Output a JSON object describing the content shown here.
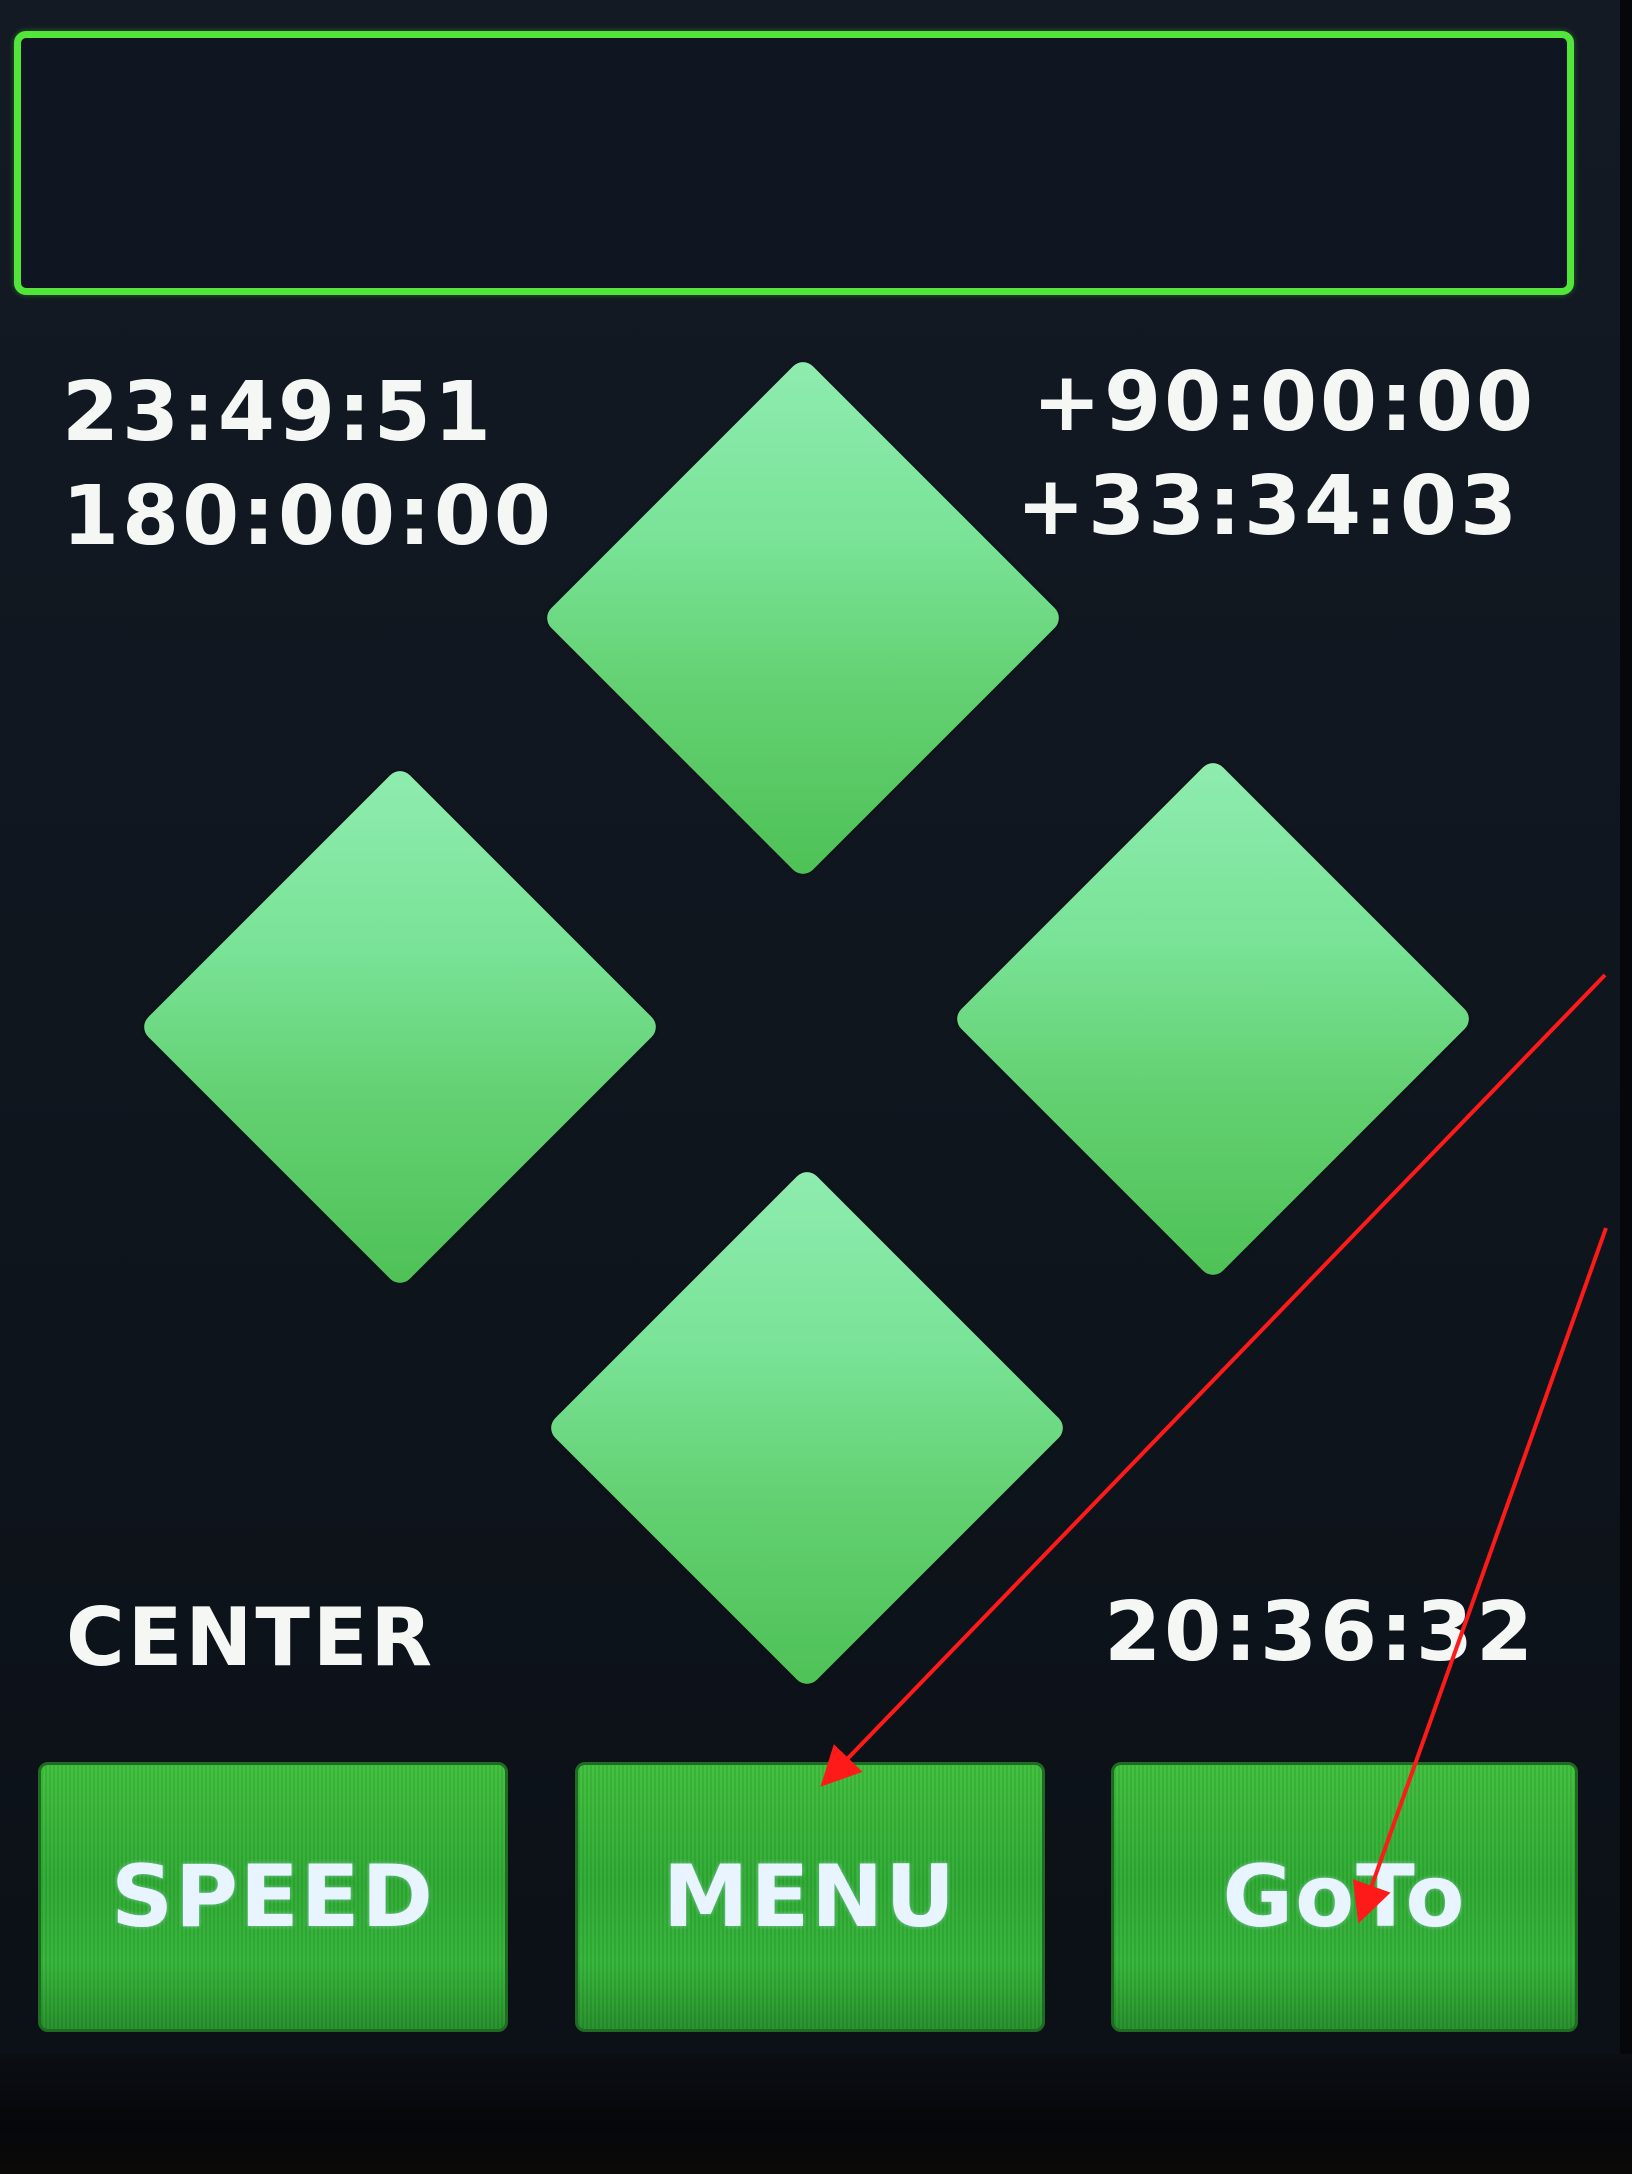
{
  "status_bar": {
    "text": ""
  },
  "readouts": {
    "time_upper": "23:49:51",
    "azimuth": "180:00:00",
    "altitude_upper": "+90:00:00",
    "altitude_lower": "+33:34:03",
    "mode": "CENTER",
    "time_lower": "20:36:32"
  },
  "dpad": {
    "up": "arrow-up",
    "left": "arrow-left",
    "right": "arrow-right",
    "down": "arrow-down"
  },
  "buttons": {
    "speed": "SPEED",
    "menu": "MENU",
    "goto": "GoTo"
  },
  "colors": {
    "background": "#0f151d",
    "status_border": "#53e63a",
    "dpad_light": "#8fecb0",
    "dpad_dark": "#4ec156",
    "button_green": "#2eaa33",
    "button_text": "#e8f4ff",
    "readout_text": "#f4f7f4",
    "annotation_arrow": "#ff1a1a"
  }
}
